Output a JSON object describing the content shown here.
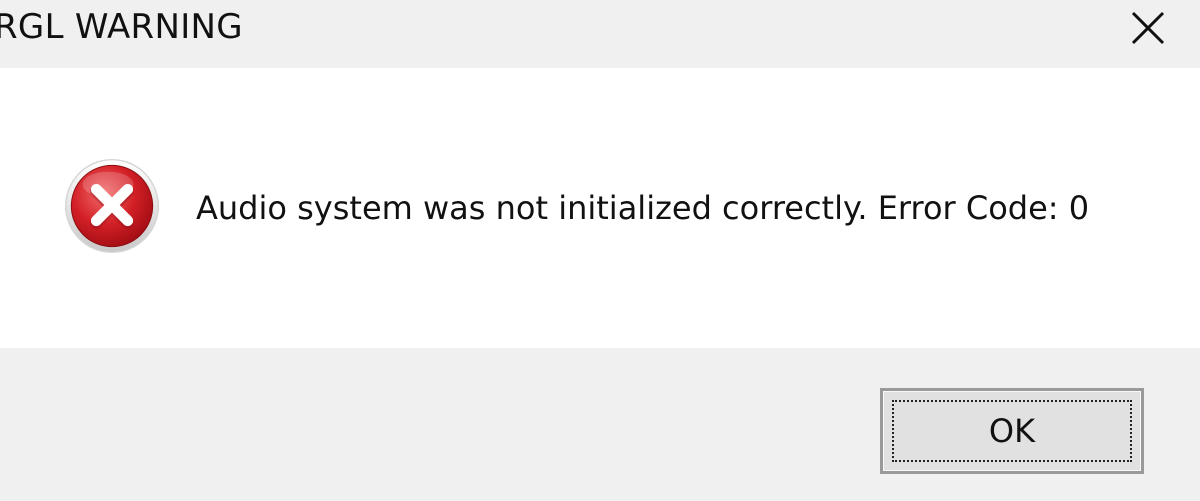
{
  "window": {
    "title": "RGL WARNING",
    "close_icon": "close-icon"
  },
  "dialog": {
    "icon": "error-icon",
    "message": "Audio system was not initialized correctly. Error Code: 0"
  },
  "buttons": {
    "ok_label": "OK"
  },
  "colors": {
    "titlebar_bg": "#f0f0f0",
    "content_bg": "#ffffff",
    "error_red": "#c8161d"
  }
}
